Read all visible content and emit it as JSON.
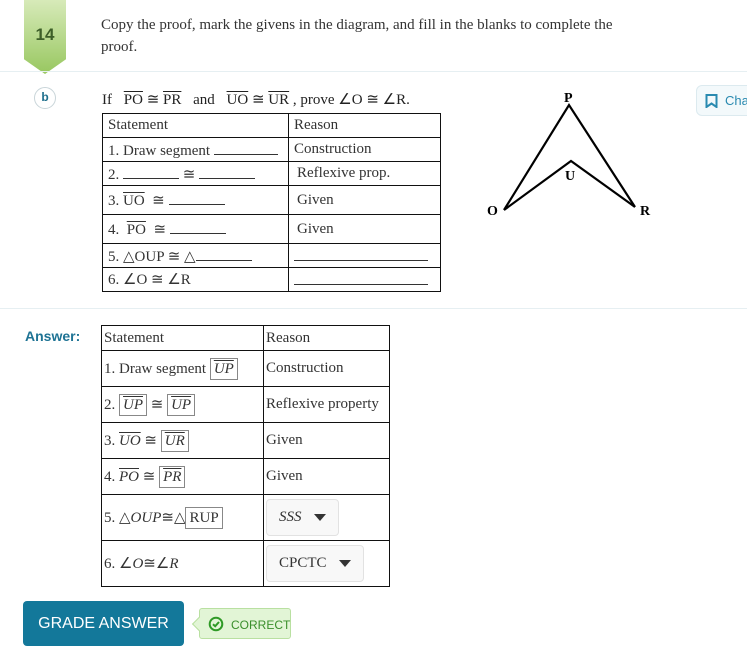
{
  "problem": {
    "number": "14",
    "instructions": "Copy the proof, mark the givens in the diagram, and fill in the blanks to complete the proof.",
    "part": "b",
    "given": {
      "if": "If",
      "seg1": "PO",
      "cong": "≅",
      "seg2": "PR",
      "and": "and",
      "seg3": "UO",
      "seg4": "UR",
      "prove": ", prove ∠O ≅ ∠R."
    },
    "table": {
      "headers": [
        "Statement",
        "Reason"
      ],
      "rows": [
        {
          "statement": "1. Draw segment",
          "reason": "Construction"
        },
        {
          "statement": "2.",
          "reason": "Reflexive prop."
        },
        {
          "statement_prefix": "3.",
          "statement_seg": "UO",
          "reason": "Given"
        },
        {
          "statement_prefix": "4.",
          "statement_seg": "PO",
          "reason": "Given"
        },
        {
          "statement": "5. △OUP ≅ △",
          "reason": ""
        },
        {
          "statement": "6. ∠O ≅ ∠R",
          "reason": ""
        }
      ]
    },
    "diagram": {
      "points": [
        "P",
        "U",
        "O",
        "R"
      ]
    }
  },
  "chapter_tab": {
    "label": "Cha",
    "icon": "bookmark-icon"
  },
  "answer": {
    "label": "Answer:",
    "headers": [
      "Statement",
      "Reason"
    ],
    "rows": [
      {
        "prefix": "1. Draw segment",
        "box": "UP",
        "reason": "Construction"
      },
      {
        "prefix": "2.",
        "left": "UP",
        "cong": "≅",
        "right": "UP",
        "reason": "Reflexive property"
      },
      {
        "prefix": "3.",
        "left": "UO",
        "cong": "≅",
        "right": "UR",
        "reason": "Given"
      },
      {
        "prefix": "4.",
        "left": "PO",
        "cong": "≅",
        "right": "PR",
        "reason": "Given"
      },
      {
        "prefix": "5. △",
        "left": "OUP",
        "cong": "≅△",
        "right": "RUP",
        "reason_select": "SSS"
      },
      {
        "prefix": "6. ∠",
        "left": "O",
        "cong": "≅∠",
        "right": "R",
        "reason_select": "CPCTC"
      }
    ]
  },
  "grade_button": "GRADE ANSWER",
  "status": {
    "label": "CORRECT",
    "icon": "check-circle-icon",
    "color": "#3a8f2b"
  },
  "colors": {
    "accent": "#13789a",
    "badge_green": "#98c760"
  }
}
